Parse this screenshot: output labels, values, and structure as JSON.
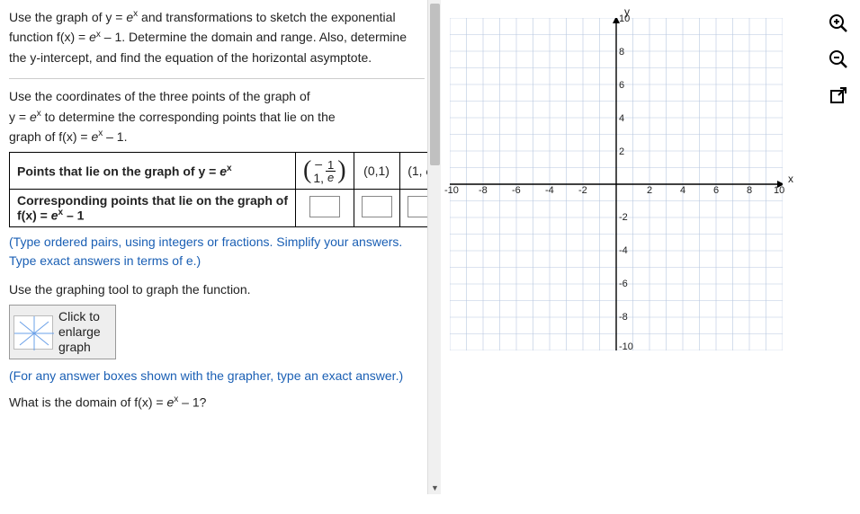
{
  "intro": {
    "line1_a": "Use the graph of y = ",
    "line1_b": " and transformations to sketch the",
    "line2_a": "exponential function f(x) = ",
    "line2_b": " – 1. Determine the domain and",
    "line3": "range. Also, determine the y-intercept, and find the equation of the horizontal asymptote."
  },
  "instr": {
    "l1": "Use the coordinates of the three points of the graph of",
    "l2_a": "y = ",
    "l2_b": " to determine the corresponding points that lie on the",
    "l3_a": "graph of f(x) = ",
    "l3_b": " – 1."
  },
  "table": {
    "row1_a": "Points that lie on the graph of y = ",
    "p1_pre": "– 1,",
    "p1_num": "1",
    "p1_den": "e",
    "p2": "(0,1)",
    "p3_a": "(1, ",
    "p3_b": ")",
    "row2_a": "Corresponding points that lie on the graph of",
    "row2_b": "f(x) = ",
    "row2_c": " – 1"
  },
  "hint": "(Type ordered pairs, using integers or fractions. Simplify your answers. Type exact answers in terms of e.)",
  "use_tool": "Use the graphing tool to graph the function.",
  "graph_btn": {
    "l1": "Click to",
    "l2": "enlarge",
    "l3": "graph"
  },
  "note": "(For any answer boxes shown with the grapher, type an exact answer.)",
  "bottom_q_a": "What is the domain of f(x) = ",
  "bottom_q_b": " – 1?",
  "e_sup": "e",
  "x_sup": "x",
  "axis": {
    "y": "y",
    "x": "x",
    "xticks": [
      "-10",
      "-8",
      "-6",
      "-4",
      "-2",
      "2",
      "4",
      "6",
      "8",
      "10"
    ],
    "yticks": [
      "10",
      "8",
      "6",
      "4",
      "2",
      "-2",
      "-4",
      "-6",
      "-8",
      "-10"
    ]
  },
  "tools": {
    "zoom_in": "zoom-in-icon",
    "zoom_out": "zoom-out-icon",
    "popout": "popout-icon"
  }
}
